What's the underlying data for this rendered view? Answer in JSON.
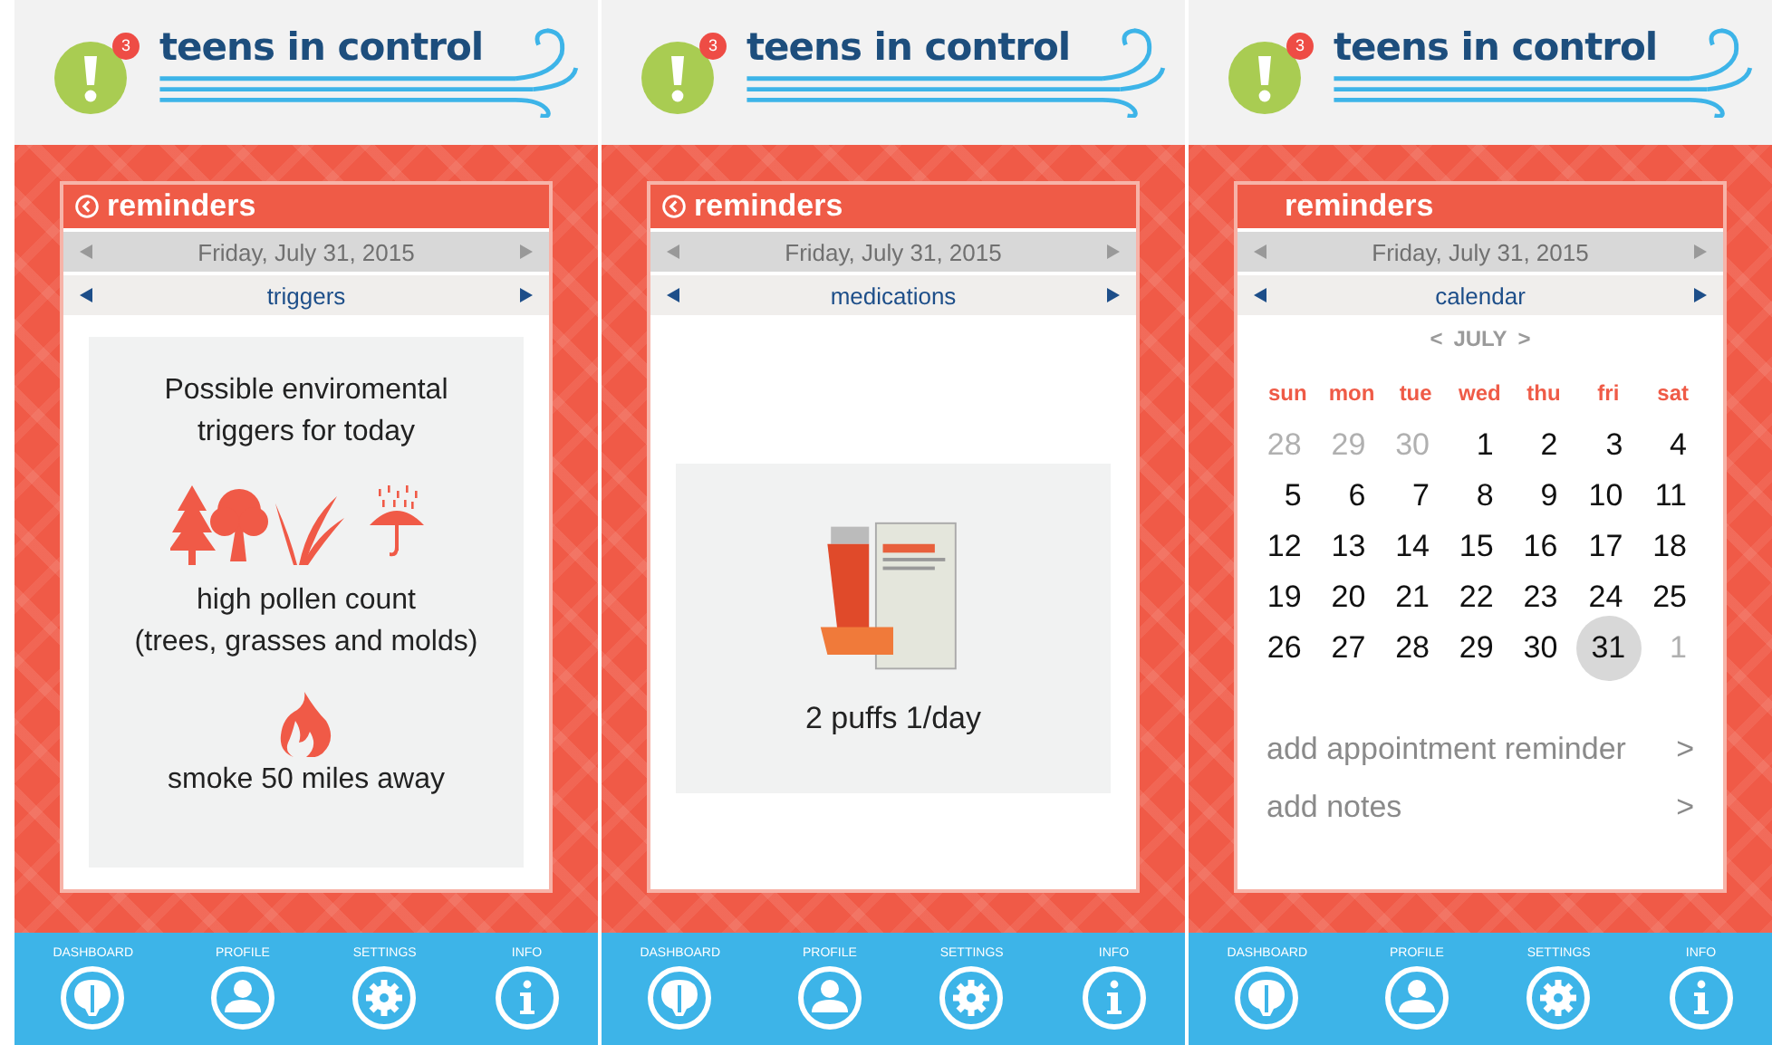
{
  "screens": [
    {
      "kind": "triggers",
      "badge": "3",
      "brand": "teens in control",
      "title": "reminders",
      "back_button": true,
      "date": "Friday, July 31, 2015",
      "category": "triggers",
      "heading": "Possible enviromental triggers for today",
      "pollen_lines": [
        "high pollen count",
        "(trees, grasses and molds)"
      ],
      "smoke": "smoke 50 miles away",
      "nav": [
        {
          "kind": "dashboard",
          "label": "DASHBOARD"
        },
        {
          "kind": "profile",
          "label": "PROFILE"
        },
        {
          "kind": "settings",
          "label": "SETTINGS"
        },
        {
          "kind": "info",
          "label": "INFO"
        }
      ]
    },
    {
      "kind": "medications",
      "badge": "3",
      "brand": "teens in control",
      "title": "reminders",
      "back_button": true,
      "date": "Friday, July 31, 2015",
      "category": "medications",
      "dose": "2 puffs 1/day",
      "nav": [
        {
          "kind": "dashboard",
          "label": "DASHBOARD"
        },
        {
          "kind": "profile",
          "label": "PROFILE"
        },
        {
          "kind": "settings",
          "label": "SETTINGS"
        },
        {
          "kind": "info",
          "label": "INFO"
        }
      ]
    },
    {
      "kind": "calendar",
      "badge": "3",
      "brand": "teens in control",
      "title": "reminders",
      "back_button": false,
      "date": "Friday, July 31, 2015",
      "category": "calendar",
      "month": {
        "prev": "<",
        "name": "JULY",
        "next": ">"
      },
      "weekdays": [
        "sun",
        "mon",
        "tue",
        "wed",
        "thu",
        "fri",
        "sat"
      ],
      "weeks": [
        [
          {
            "day": "28",
            "muted": true,
            "selected": false
          },
          {
            "day": "29",
            "muted": true,
            "selected": false
          },
          {
            "day": "30",
            "muted": true,
            "selected": false
          },
          {
            "day": "1",
            "muted": false,
            "selected": false
          },
          {
            "day": "2",
            "muted": false,
            "selected": false
          },
          {
            "day": "3",
            "muted": false,
            "selected": false
          },
          {
            "day": "4",
            "muted": false,
            "selected": false
          }
        ],
        [
          {
            "day": "5",
            "muted": false,
            "selected": false
          },
          {
            "day": "6",
            "muted": false,
            "selected": false
          },
          {
            "day": "7",
            "muted": false,
            "selected": false
          },
          {
            "day": "8",
            "muted": false,
            "selected": false
          },
          {
            "day": "9",
            "muted": false,
            "selected": false
          },
          {
            "day": "10",
            "muted": false,
            "selected": false
          },
          {
            "day": "11",
            "muted": false,
            "selected": false
          }
        ],
        [
          {
            "day": "12",
            "muted": false,
            "selected": false
          },
          {
            "day": "13",
            "muted": false,
            "selected": false
          },
          {
            "day": "14",
            "muted": false,
            "selected": false
          },
          {
            "day": "15",
            "muted": false,
            "selected": false
          },
          {
            "day": "16",
            "muted": false,
            "selected": false
          },
          {
            "day": "17",
            "muted": false,
            "selected": false
          },
          {
            "day": "18",
            "muted": false,
            "selected": false
          }
        ],
        [
          {
            "day": "19",
            "muted": false,
            "selected": false
          },
          {
            "day": "20",
            "muted": false,
            "selected": false
          },
          {
            "day": "21",
            "muted": false,
            "selected": false
          },
          {
            "day": "22",
            "muted": false,
            "selected": false
          },
          {
            "day": "23",
            "muted": false,
            "selected": false
          },
          {
            "day": "24",
            "muted": false,
            "selected": false
          },
          {
            "day": "25",
            "muted": false,
            "selected": false
          }
        ],
        [
          {
            "day": "26",
            "muted": false,
            "selected": false
          },
          {
            "day": "27",
            "muted": false,
            "selected": false
          },
          {
            "day": "28",
            "muted": false,
            "selected": false
          },
          {
            "day": "29",
            "muted": false,
            "selected": false
          },
          {
            "day": "30",
            "muted": false,
            "selected": false
          },
          {
            "day": "31",
            "muted": false,
            "selected": true
          },
          {
            "day": "1",
            "muted": true,
            "selected": false
          }
        ]
      ],
      "actions": [
        {
          "label": "add appointment reminder",
          "arrow": ">"
        },
        {
          "label": "add notes",
          "arrow": ">"
        }
      ],
      "nav": [
        {
          "kind": "dashboard",
          "label": "DASHBOARD"
        },
        {
          "kind": "profile",
          "label": "PROFILE"
        },
        {
          "kind": "settings",
          "label": "SETTINGS"
        },
        {
          "kind": "info",
          "label": "INFO"
        }
      ]
    }
  ]
}
